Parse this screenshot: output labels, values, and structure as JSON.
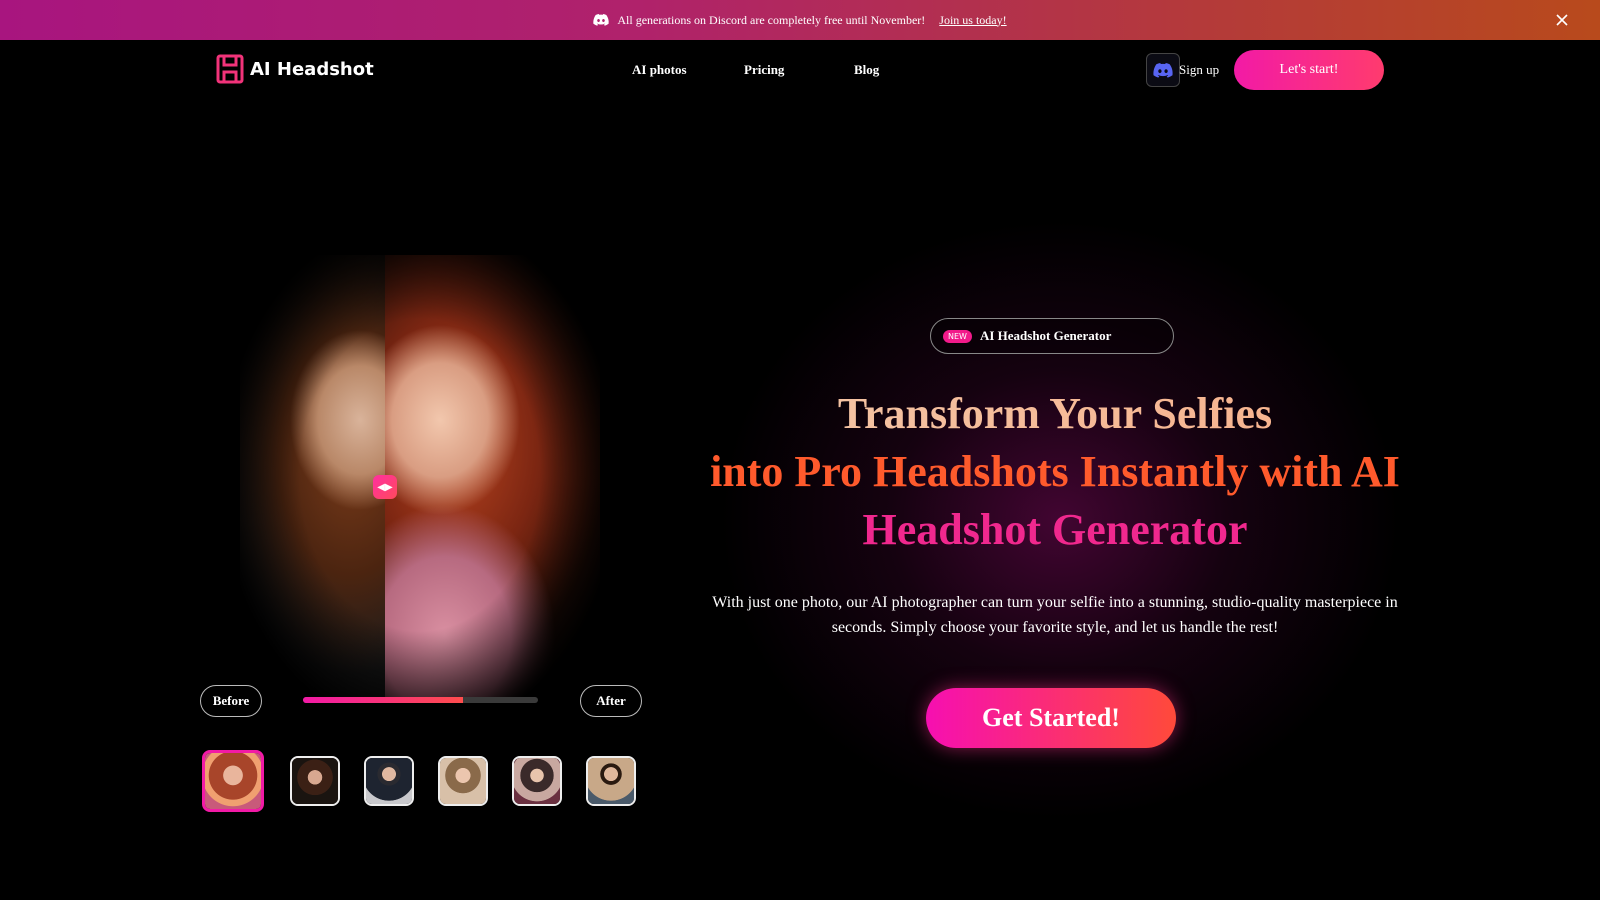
{
  "announcement": {
    "text": "All generations on Discord are completely free until November!",
    "link": "Join us today!"
  },
  "nav": {
    "logo_text": "AI Headshot",
    "links": [
      "AI photos",
      "Pricing",
      "Blog"
    ],
    "signup": "Sign up",
    "start": "Let's start!"
  },
  "comparison": {
    "before_label": "Before",
    "after_label": "After",
    "progress": 0.68,
    "thumbnails": [
      "portrait-woman-red-hair",
      "portrait-woman-dark",
      "portrait-man-suit",
      "portrait-woman-blonde",
      "portrait-woman-gown",
      "portrait-man-beige-suit"
    ],
    "active_thumbnail": 0
  },
  "hero": {
    "badge_new": "NEW",
    "badge_text": "AI Headshot Generator",
    "headline_line1": "Transform Your Selfies",
    "headline_line2": "into Pro Headshots Instantly with AI",
    "headline_line3": "Headshot Generator",
    "subtitle": "With just one photo, our AI photographer can turn your selfie into a stunning, studio-quality masterpiece in seconds. Simply choose your favorite style, and let us handle the rest!",
    "cta": "Get Started!"
  },
  "colors": {
    "accent_pink": "#f21aa6",
    "accent_orange": "#ff4a3a",
    "headline_peach": "#f3c7a8",
    "headline_orange": "#ff5a2c",
    "headline_pink": "#f0288e"
  }
}
